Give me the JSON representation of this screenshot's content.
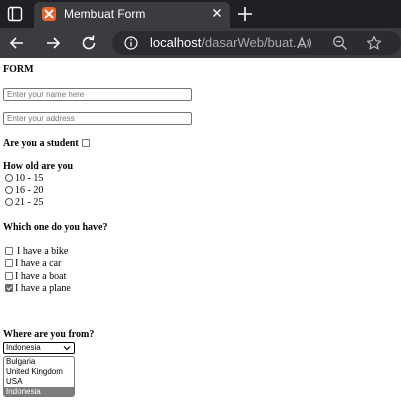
{
  "browser": {
    "tab_title": "Membuat Form",
    "url_host": "localhost",
    "url_path": "/dasarWeb/buat..."
  },
  "form": {
    "heading": "FORM",
    "name_placeholder": "Enter your name here",
    "address_placeholder": "Enter your address",
    "student_label": "Are you a student",
    "student_checked": false,
    "age_label": "How old are you",
    "age_options": [
      "10 - 15",
      "16 - 20",
      "21 - 25"
    ],
    "have_label": "Which one do you have?",
    "have_options": [
      {
        "label": "I have a bike",
        "checked": false
      },
      {
        "label": "I have a car",
        "checked": false
      },
      {
        "label": "I have a boat",
        "checked": false
      },
      {
        "label": "I have a plane",
        "checked": true
      }
    ],
    "from_label": "Where are you from?",
    "country_selected": "Indonesia",
    "country_list": [
      "Bulgaria",
      "United Kingdom",
      "USA",
      "Indonesia"
    ],
    "country_list_selected": "Indonesia"
  }
}
